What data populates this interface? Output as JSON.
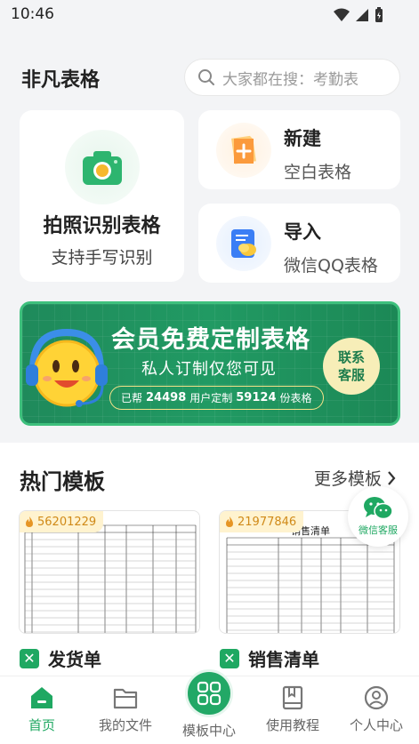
{
  "status_bar": {
    "time": "10:46"
  },
  "header": {
    "app_title": "非凡表格",
    "search_placeholder": "大家都在搜：考勤表"
  },
  "quick_actions": {
    "photo": {
      "title": "拍照识别表格",
      "subtitle": "支持手写识别"
    },
    "new": {
      "title": "新建",
      "subtitle": "空白表格"
    },
    "import": {
      "title": "导入",
      "subtitle": "微信QQ表格"
    }
  },
  "banner": {
    "title": "会员免费定制表格",
    "subtitle": "私人订制仅您可见",
    "stats_prefix": "已帮",
    "users_count": "24498",
    "stats_mid": "用户定制",
    "tables_count": "59124",
    "stats_suffix": "份表格",
    "contact_line1": "联系",
    "contact_line2": "客服"
  },
  "hot_templates": {
    "title": "热门模板",
    "more_label": "更多模板",
    "items": [
      {
        "views": "56201229",
        "name": "发货单"
      },
      {
        "views": "21977846",
        "name": "销售清单",
        "preview_title": "销售清单"
      }
    ]
  },
  "wechat_service": {
    "label": "微信客服"
  },
  "tabbar": {
    "items": [
      {
        "label": "首页"
      },
      {
        "label": "我的文件"
      },
      {
        "label": "模板中心"
      },
      {
        "label": "使用教程"
      },
      {
        "label": "个人中心"
      }
    ]
  },
  "colors": {
    "brand_green": "#1fa862",
    "banner_green": "#219a63",
    "badge_orange": "#d08a18"
  }
}
